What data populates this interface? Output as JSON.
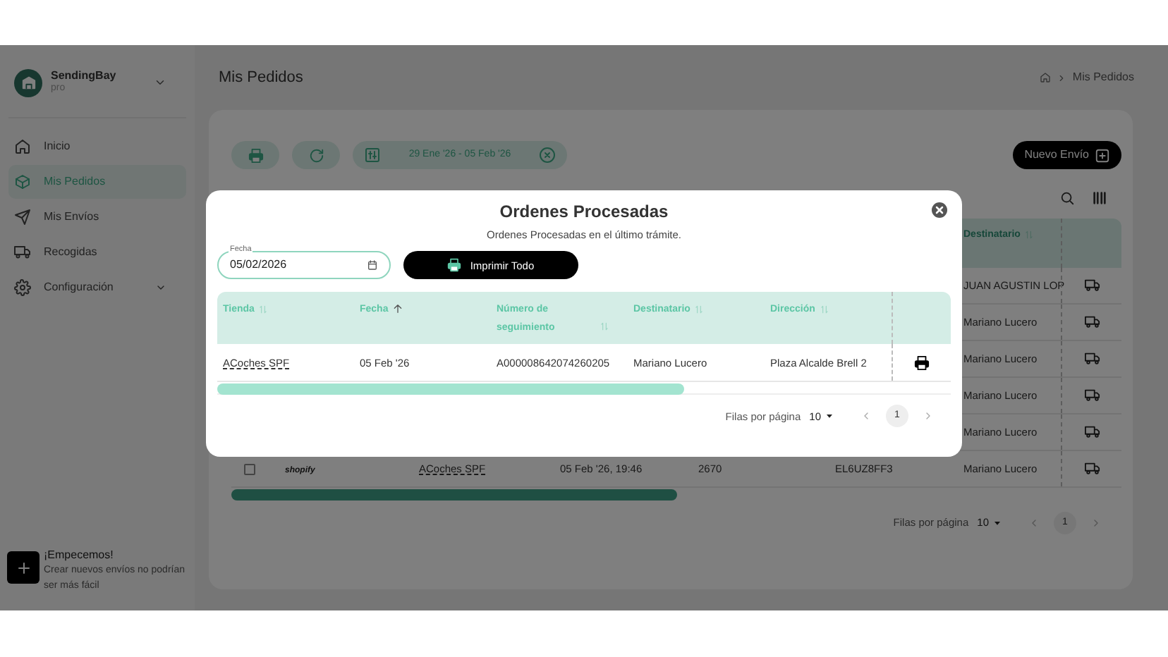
{
  "sidebar": {
    "brand": {
      "name": "SendingBay",
      "plan": "pro"
    },
    "items": [
      {
        "label": "Inicio",
        "selected": false,
        "expandable": false
      },
      {
        "label": "Mis Pedidos",
        "selected": true,
        "expandable": false
      },
      {
        "label": "Mis Envíos",
        "selected": false,
        "expandable": false
      },
      {
        "label": "Recogidas",
        "selected": false,
        "expandable": false
      },
      {
        "label": "Configuración",
        "selected": false,
        "expandable": true
      }
    ],
    "promo": {
      "title": "¡Empecemos!",
      "text": "Crear nuevos envíos no podrían ser más fácil"
    }
  },
  "page": {
    "title": "Mis Pedidos",
    "breadcrumb": [
      "Mis Pedidos"
    ]
  },
  "toolbar": {
    "date_range": "29 Ene '26 - 05 Feb '26",
    "new_button": "Nuevo Envío"
  },
  "orders_table": {
    "visible_column": "Destinatario",
    "rows": [
      {
        "destinatario": "JUAN AGUSTIN LOP"
      },
      {
        "destinatario": "Mariano Lucero"
      },
      {
        "destinatario": "Mariano Lucero"
      },
      {
        "destinatario": "Mariano Lucero"
      },
      {
        "destinatario": "Mariano Lucero"
      },
      {
        "checked": false,
        "store_logo": "shopify",
        "tienda": "ACoches SPF",
        "fecha": "05 Feb '26, 19:46",
        "column_4": "2670",
        "column_5": "EL6UZ8FF3",
        "destinatario": "Mariano Lucero"
      }
    ],
    "pagination": {
      "label": "Filas por página",
      "rows_per_page": "10",
      "page": "1"
    }
  },
  "modal": {
    "title": "Ordenes Procesadas",
    "subtitle": "Ordenes Procesadas en el último trámite.",
    "date_field": {
      "label": "Fecha",
      "value": "05/02/2026"
    },
    "print_all": "Imprimir Todo",
    "table": {
      "columns": [
        {
          "label": "Tienda",
          "sorted": false
        },
        {
          "label": "Fecha",
          "sorted": true
        },
        {
          "label": "Número de seguimiento",
          "sorted": false
        },
        {
          "label": "Destinatario",
          "sorted": false
        },
        {
          "label": "Dirección",
          "sorted": false
        }
      ],
      "rows": [
        {
          "cells": [
            "ACoches SPF",
            "05 Feb '26",
            "A000008642074260205",
            "Mariano Lucero",
            "Plaza Alcalde Brell 2"
          ]
        }
      ]
    },
    "pagination": {
      "label": "Filas por página",
      "rows_per_page": "10",
      "page": "1"
    }
  }
}
